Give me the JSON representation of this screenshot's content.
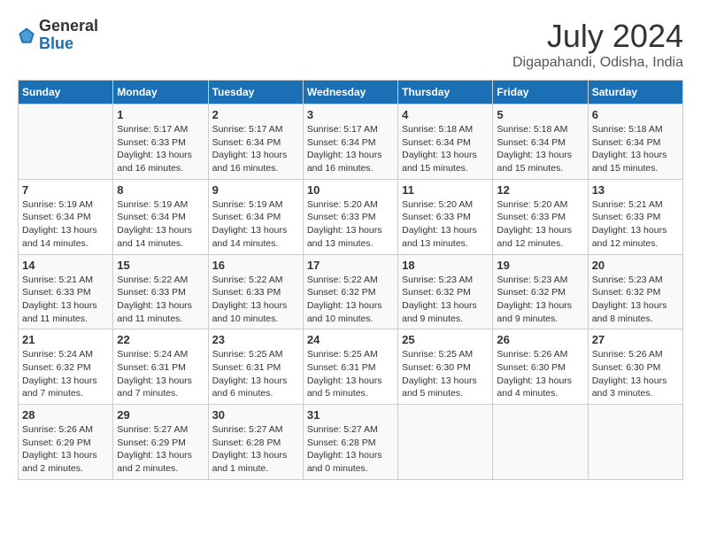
{
  "header": {
    "logo_general": "General",
    "logo_blue": "Blue",
    "title": "July 2024",
    "location": "Digapahandi, Odisha, India"
  },
  "days_of_week": [
    "Sunday",
    "Monday",
    "Tuesday",
    "Wednesday",
    "Thursday",
    "Friday",
    "Saturday"
  ],
  "weeks": [
    [
      {
        "day": "",
        "info": ""
      },
      {
        "day": "1",
        "info": "Sunrise: 5:17 AM\nSunset: 6:33 PM\nDaylight: 13 hours\nand 16 minutes."
      },
      {
        "day": "2",
        "info": "Sunrise: 5:17 AM\nSunset: 6:34 PM\nDaylight: 13 hours\nand 16 minutes."
      },
      {
        "day": "3",
        "info": "Sunrise: 5:17 AM\nSunset: 6:34 PM\nDaylight: 13 hours\nand 16 minutes."
      },
      {
        "day": "4",
        "info": "Sunrise: 5:18 AM\nSunset: 6:34 PM\nDaylight: 13 hours\nand 15 minutes."
      },
      {
        "day": "5",
        "info": "Sunrise: 5:18 AM\nSunset: 6:34 PM\nDaylight: 13 hours\nand 15 minutes."
      },
      {
        "day": "6",
        "info": "Sunrise: 5:18 AM\nSunset: 6:34 PM\nDaylight: 13 hours\nand 15 minutes."
      }
    ],
    [
      {
        "day": "7",
        "info": "Sunrise: 5:19 AM\nSunset: 6:34 PM\nDaylight: 13 hours\nand 14 minutes."
      },
      {
        "day": "8",
        "info": "Sunrise: 5:19 AM\nSunset: 6:34 PM\nDaylight: 13 hours\nand 14 minutes."
      },
      {
        "day": "9",
        "info": "Sunrise: 5:19 AM\nSunset: 6:34 PM\nDaylight: 13 hours\nand 14 minutes."
      },
      {
        "day": "10",
        "info": "Sunrise: 5:20 AM\nSunset: 6:33 PM\nDaylight: 13 hours\nand 13 minutes."
      },
      {
        "day": "11",
        "info": "Sunrise: 5:20 AM\nSunset: 6:33 PM\nDaylight: 13 hours\nand 13 minutes."
      },
      {
        "day": "12",
        "info": "Sunrise: 5:20 AM\nSunset: 6:33 PM\nDaylight: 13 hours\nand 12 minutes."
      },
      {
        "day": "13",
        "info": "Sunrise: 5:21 AM\nSunset: 6:33 PM\nDaylight: 13 hours\nand 12 minutes."
      }
    ],
    [
      {
        "day": "14",
        "info": "Sunrise: 5:21 AM\nSunset: 6:33 PM\nDaylight: 13 hours\nand 11 minutes."
      },
      {
        "day": "15",
        "info": "Sunrise: 5:22 AM\nSunset: 6:33 PM\nDaylight: 13 hours\nand 11 minutes."
      },
      {
        "day": "16",
        "info": "Sunrise: 5:22 AM\nSunset: 6:33 PM\nDaylight: 13 hours\nand 10 minutes."
      },
      {
        "day": "17",
        "info": "Sunrise: 5:22 AM\nSunset: 6:32 PM\nDaylight: 13 hours\nand 10 minutes."
      },
      {
        "day": "18",
        "info": "Sunrise: 5:23 AM\nSunset: 6:32 PM\nDaylight: 13 hours\nand 9 minutes."
      },
      {
        "day": "19",
        "info": "Sunrise: 5:23 AM\nSunset: 6:32 PM\nDaylight: 13 hours\nand 9 minutes."
      },
      {
        "day": "20",
        "info": "Sunrise: 5:23 AM\nSunset: 6:32 PM\nDaylight: 13 hours\nand 8 minutes."
      }
    ],
    [
      {
        "day": "21",
        "info": "Sunrise: 5:24 AM\nSunset: 6:32 PM\nDaylight: 13 hours\nand 7 minutes."
      },
      {
        "day": "22",
        "info": "Sunrise: 5:24 AM\nSunset: 6:31 PM\nDaylight: 13 hours\nand 7 minutes."
      },
      {
        "day": "23",
        "info": "Sunrise: 5:25 AM\nSunset: 6:31 PM\nDaylight: 13 hours\nand 6 minutes."
      },
      {
        "day": "24",
        "info": "Sunrise: 5:25 AM\nSunset: 6:31 PM\nDaylight: 13 hours\nand 5 minutes."
      },
      {
        "day": "25",
        "info": "Sunrise: 5:25 AM\nSunset: 6:30 PM\nDaylight: 13 hours\nand 5 minutes."
      },
      {
        "day": "26",
        "info": "Sunrise: 5:26 AM\nSunset: 6:30 PM\nDaylight: 13 hours\nand 4 minutes."
      },
      {
        "day": "27",
        "info": "Sunrise: 5:26 AM\nSunset: 6:30 PM\nDaylight: 13 hours\nand 3 minutes."
      }
    ],
    [
      {
        "day": "28",
        "info": "Sunrise: 5:26 AM\nSunset: 6:29 PM\nDaylight: 13 hours\nand 2 minutes."
      },
      {
        "day": "29",
        "info": "Sunrise: 5:27 AM\nSunset: 6:29 PM\nDaylight: 13 hours\nand 2 minutes."
      },
      {
        "day": "30",
        "info": "Sunrise: 5:27 AM\nSunset: 6:28 PM\nDaylight: 13 hours\nand 1 minute."
      },
      {
        "day": "31",
        "info": "Sunrise: 5:27 AM\nSunset: 6:28 PM\nDaylight: 13 hours\nand 0 minutes."
      },
      {
        "day": "",
        "info": ""
      },
      {
        "day": "",
        "info": ""
      },
      {
        "day": "",
        "info": ""
      }
    ]
  ]
}
